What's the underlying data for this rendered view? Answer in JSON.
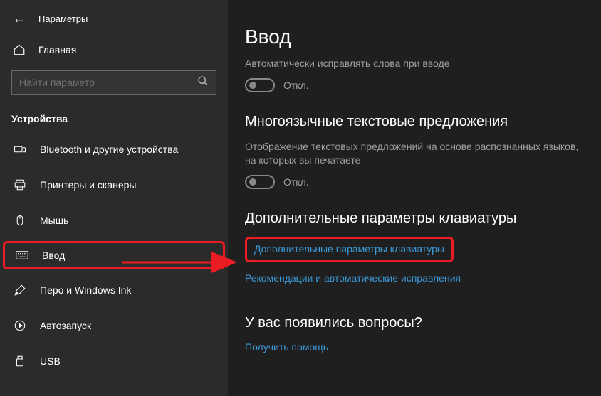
{
  "header": {
    "app_title": "Параметры"
  },
  "sidebar": {
    "home_label": "Главная",
    "search_placeholder": "Найти параметр",
    "category": "Устройства",
    "items": [
      {
        "label": "Bluetooth и другие устройства"
      },
      {
        "label": "Принтеры и сканеры"
      },
      {
        "label": "Мышь"
      },
      {
        "label": "Ввод"
      },
      {
        "label": "Перо и Windows Ink"
      },
      {
        "label": "Автозапуск"
      },
      {
        "label": "USB"
      }
    ]
  },
  "main": {
    "title": "Ввод",
    "autocorrect_desc": "Автоматически исправлять слова при вводе",
    "toggle_off": "Откл.",
    "section2_title": "Многоязычные текстовые предложения",
    "section2_desc": "Отображение текстовых предложений на основе распознанных языков, на которых вы печатаете",
    "section3_title": "Дополнительные параметры клавиатуры",
    "link_advanced": "Дополнительные параметры клавиатуры",
    "link_recommend": "Рекомендации и автоматические исправления",
    "questions_title": "У вас появились вопросы?",
    "link_help": "Получить помощь"
  }
}
